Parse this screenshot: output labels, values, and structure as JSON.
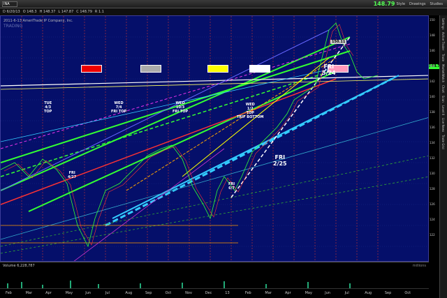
{
  "window": {
    "symbol": "INA",
    "price": "148.79",
    "toolbar": [
      "Style",
      "Drawings",
      "Studies"
    ]
  },
  "info": {
    "interval": "D 6/20/13",
    "o": "O 148.3",
    "h": "H 148.37",
    "l": "L 147.87",
    "c": "C 148.79",
    "r": "R 1.1",
    "description": "2011-6-13 AmeriTrade IP Company, Inc."
  },
  "chart": {
    "watermark": "TRADING",
    "current_price_label": "148.79",
    "right_axis_ticks": [
      "150",
      "148",
      "146",
      "144",
      "142",
      "140",
      "138",
      "136",
      "134",
      "132",
      "130",
      "128",
      "126",
      "124",
      "122"
    ],
    "months": [
      "Feb",
      "Mar",
      "Apr",
      "May",
      "Jun",
      "Jul",
      "Aug",
      "Sep",
      "Oct",
      "Nov",
      "Dec",
      "13",
      "Feb",
      "Mar",
      "Apr",
      "May",
      "Jun",
      "Jul",
      "Aug",
      "Sep",
      "Oct"
    ]
  },
  "annotations": {
    "tue": "TUE\n4/3\nTOP",
    "wed1": "WED\n7/4\nFRI TOP",
    "wed2": "WED\n10/3\nFRI TOP",
    "wed3": "WED\n1/2\nTOP\nTRIF BOTTOM",
    "fri1": "FRI\n4/27",
    "fri2": "FRI\n6/7",
    "fri3": "FRI\n2/25",
    "fri4": "FRI\n5/24",
    "hi": "150.11"
  },
  "volume": {
    "label": "Volume",
    "value": "6,228,787",
    "right": "millions"
  },
  "right_tabs": [
    "Settings",
    "Active Trader",
    "Trade",
    "MarketWatch",
    "Chart",
    "Scan",
    "Level II",
    "Live News",
    "Trade Grid"
  ]
}
